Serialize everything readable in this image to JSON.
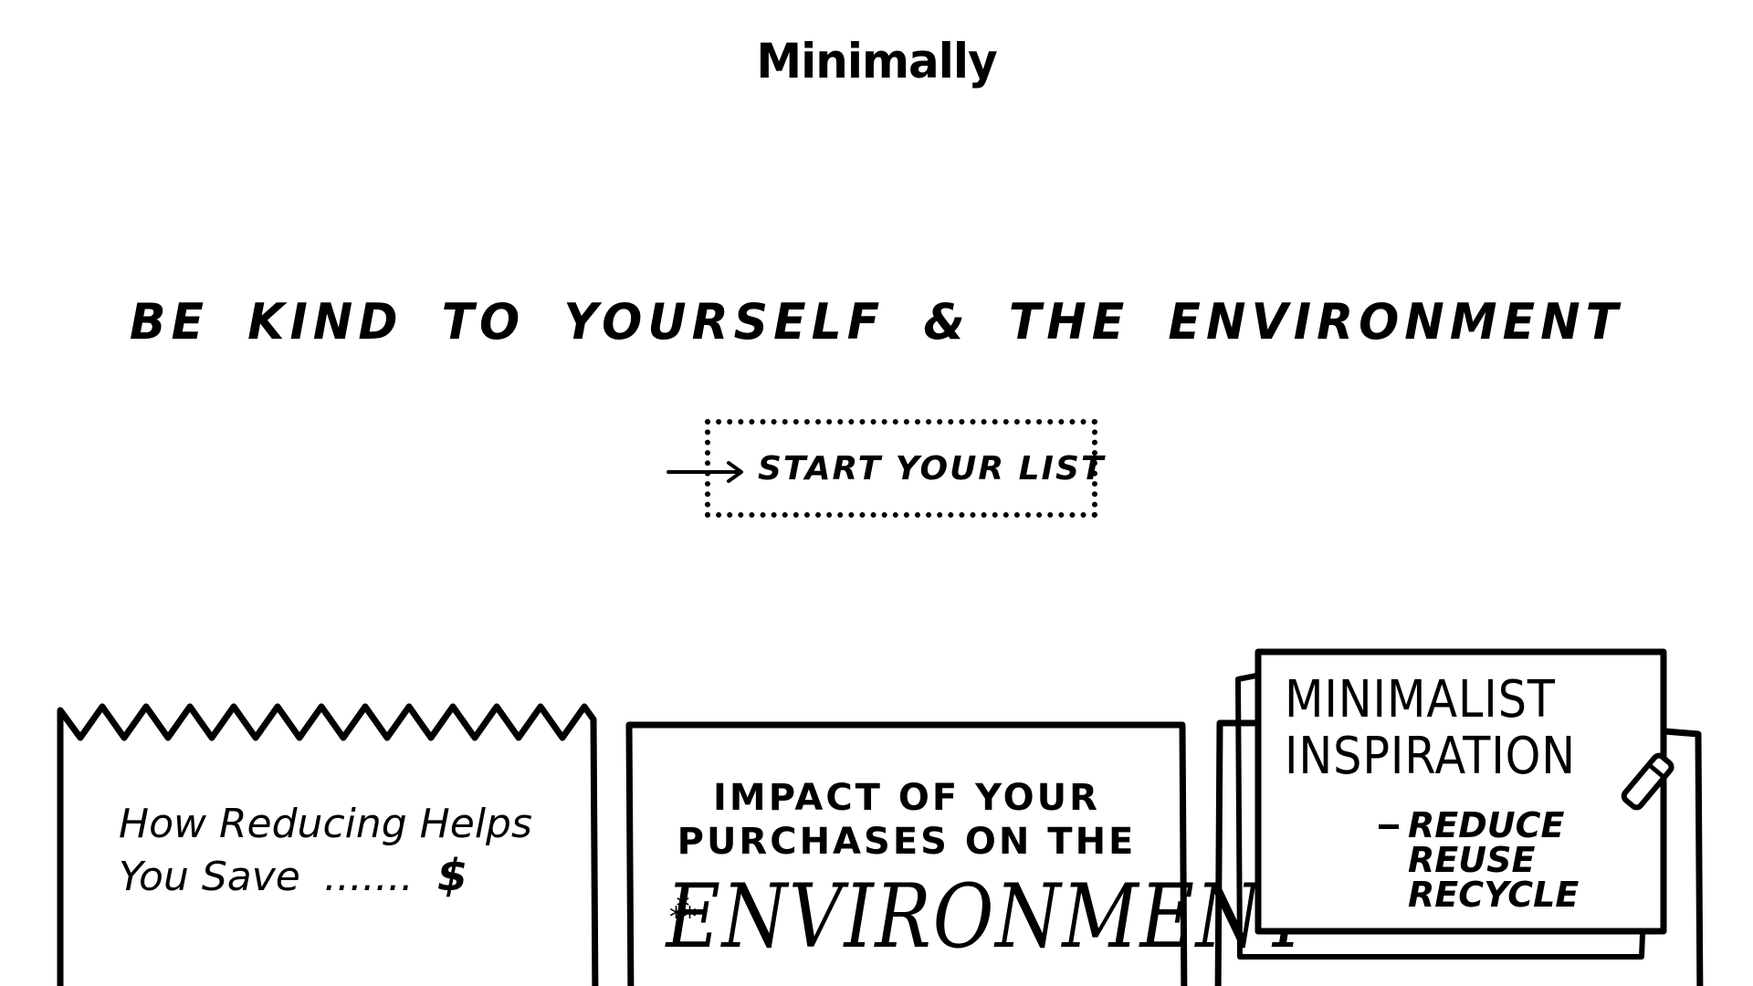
{
  "header": {
    "logo": "Minimally"
  },
  "hero": {
    "title": "BE KIND TO YOURSELF & THE ENVIRONMENT",
    "cta_label": "START YOUR LIST",
    "cta_icon": "arrow-right-icon"
  },
  "cards": {
    "savings": {
      "title_line1": "How Reducing Helps",
      "title_line2": "You Save",
      "leader": ".......",
      "symbol": "$"
    },
    "impact": {
      "title_line1": "IMPACT OF YOUR",
      "title_line2": "PURCHASES ON THE",
      "highlight": "ENVIRONMENT"
    },
    "inspiration": {
      "title_line1": "MINIMALIST",
      "title_line2": "INSPIRATION",
      "items": [
        "REDUCE",
        "REUSE",
        "RECYCLE"
      ],
      "icon": "pencil-icon"
    }
  }
}
